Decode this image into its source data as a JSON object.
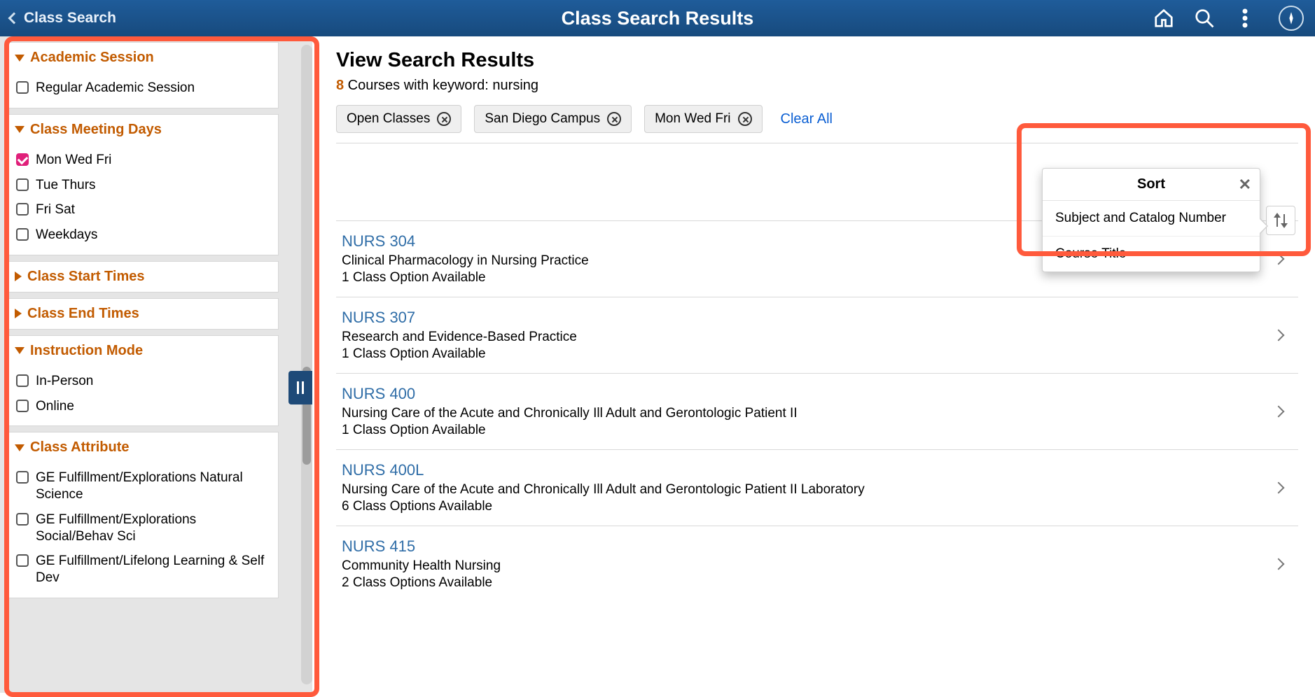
{
  "header": {
    "back_label": "Class Search",
    "title": "Class Search Results"
  },
  "sidebar": {
    "groups": [
      {
        "title": "Academic Session",
        "expanded": true,
        "options": [
          {
            "label": "Regular Academic Session",
            "checked": false
          }
        ]
      },
      {
        "title": "Class Meeting Days",
        "expanded": true,
        "options": [
          {
            "label": "Mon Wed Fri",
            "checked": true
          },
          {
            "label": "Tue Thurs",
            "checked": false
          },
          {
            "label": "Fri Sat",
            "checked": false
          },
          {
            "label": "Weekdays",
            "checked": false
          }
        ]
      },
      {
        "title": "Class Start Times",
        "expanded": false,
        "options": []
      },
      {
        "title": "Class End Times",
        "expanded": false,
        "options": []
      },
      {
        "title": "Instruction Mode",
        "expanded": true,
        "options": [
          {
            "label": "In-Person",
            "checked": false
          },
          {
            "label": "Online",
            "checked": false
          }
        ]
      },
      {
        "title": "Class Attribute",
        "expanded": true,
        "options": [
          {
            "label": "GE Fulfillment/Explorations Natural Science",
            "checked": false
          },
          {
            "label": "GE Fulfillment/Explorations Social/Behav Sci",
            "checked": false
          },
          {
            "label": "GE Fulfillment/Lifelong Learning & Self Dev",
            "checked": false
          }
        ]
      }
    ]
  },
  "main": {
    "heading": "View Search Results",
    "summary_count": "8",
    "summary_rest": " Courses with keyword: nursing",
    "chips": [
      {
        "label": "Open Classes"
      },
      {
        "label": "San Diego Campus"
      },
      {
        "label": "Mon Wed Fri"
      }
    ],
    "clear_all": "Clear All",
    "sort_popover": {
      "title": "Sort",
      "options": [
        {
          "label": "Subject and Catalog Number"
        },
        {
          "label": "Course Title"
        }
      ]
    },
    "results": [
      {
        "code": "NURS 304",
        "title": "Clinical Pharmacology in Nursing Practice",
        "sub": "1 Class Option Available"
      },
      {
        "code": "NURS 307",
        "title": "Research and Evidence-Based Practice",
        "sub": "1 Class Option Available"
      },
      {
        "code": "NURS 400",
        "title": "Nursing Care of the Acute and Chronically Ill Adult and Gerontologic Patient II",
        "sub": "1 Class Option Available"
      },
      {
        "code": "NURS 400L",
        "title": "Nursing Care of the Acute and Chronically Ill Adult and Gerontologic Patient II Laboratory",
        "sub": "6 Class Options Available"
      },
      {
        "code": "NURS 415",
        "title": "Community Health Nursing",
        "sub": "2 Class Options Available"
      }
    ]
  }
}
